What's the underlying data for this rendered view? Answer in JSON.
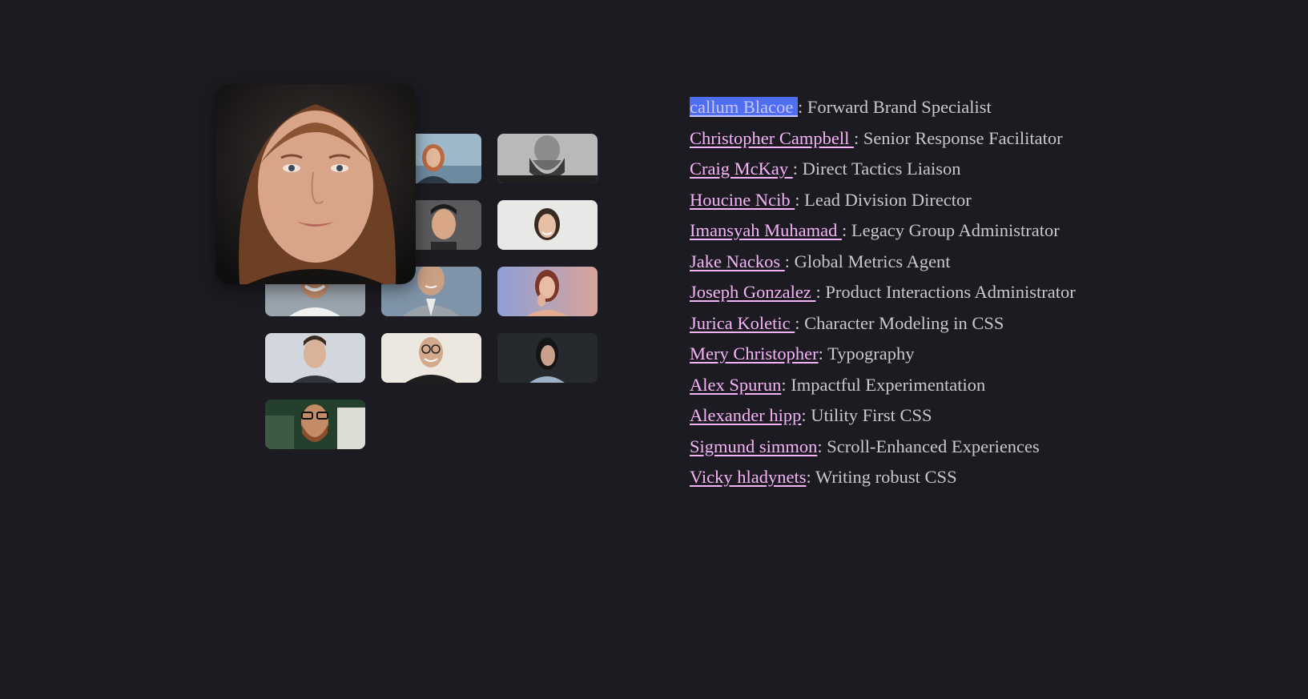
{
  "speakers": [
    {
      "name": "callum Blacoe ",
      "role": ": Forward Brand Specialist"
    },
    {
      "name": "Christopher Campbell ",
      "role": ": Senior Response Facilitator"
    },
    {
      "name": "Craig McKay ",
      "role": ": Direct Tactics Liaison"
    },
    {
      "name": "Houcine Ncib ",
      "role": ": Lead Division Director"
    },
    {
      "name": "Imansyah Muhamad ",
      "role": ": Legacy Group Administrator"
    },
    {
      "name": "Jake Nackos ",
      "role": ": Global Metrics Agent"
    },
    {
      "name": "Joseph Gonzalez ",
      "role": ": Product Interactions Administrator"
    },
    {
      "name": "Jurica Koletic ",
      "role": ": Character Modeling in CSS"
    },
    {
      "name": "Mery Christopher",
      "role": ": Typography"
    },
    {
      "name": "Alex Spurun",
      "role": ": Impactful Experimentation"
    },
    {
      "name": "Alexander hipp",
      "role": ": Utility First CSS"
    },
    {
      "name": "Sigmund simmon",
      "role": ": Scroll-Enhanced Experiences"
    },
    {
      "name": "Vicky hladynets",
      "role": ": Writing robust CSS"
    }
  ],
  "selected_index": 0,
  "colors": {
    "background": "#1c1b21",
    "link": "#f6b4f8",
    "text": "#c9c8ce",
    "selection": "#4f6ef2"
  }
}
